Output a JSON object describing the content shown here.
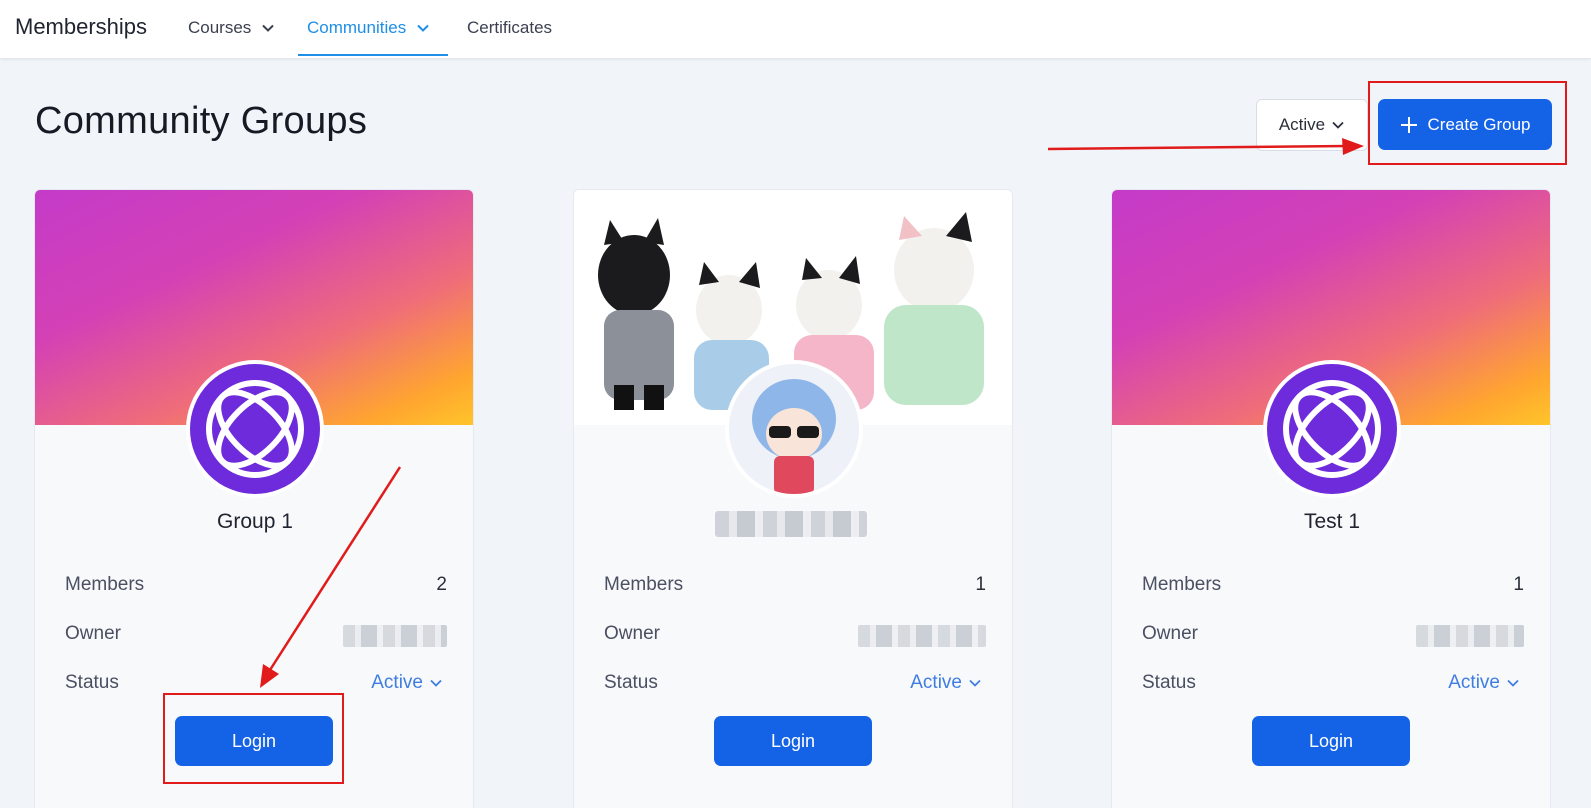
{
  "nav": {
    "brand": "Memberships",
    "items": [
      {
        "label": "Courses",
        "has_dropdown": true,
        "active": false
      },
      {
        "label": "Communities",
        "has_dropdown": true,
        "active": true
      },
      {
        "label": "Certificates",
        "has_dropdown": false,
        "active": false
      }
    ]
  },
  "header": {
    "title": "Community Groups",
    "status_filter": "Active",
    "create_button": "Create Group"
  },
  "cards": [
    {
      "name": "Group 1",
      "members_label": "Members",
      "members": "2",
      "owner_label": "Owner",
      "status_label": "Status",
      "status": "Active",
      "login": "Login"
    },
    {
      "name": "",
      "members_label": "Members",
      "members": "1",
      "owner_label": "Owner",
      "status_label": "Status",
      "status": "Active",
      "login": "Login"
    },
    {
      "name": "Test 1",
      "members_label": "Members",
      "members": "1",
      "owner_label": "Owner",
      "status_label": "Status",
      "status": "Active",
      "login": "Login"
    }
  ],
  "colors": {
    "accent": "#1463e6",
    "nav_active": "#1e8fe6",
    "status_link": "#3f7ee0",
    "avatar_purple": "#6d2bdb",
    "annotation_red": "#e11b1b"
  },
  "icons": {
    "dropdown": "chevron-down-icon",
    "create": "plus-icon",
    "group_avatar": "orbit-logo-icon"
  }
}
